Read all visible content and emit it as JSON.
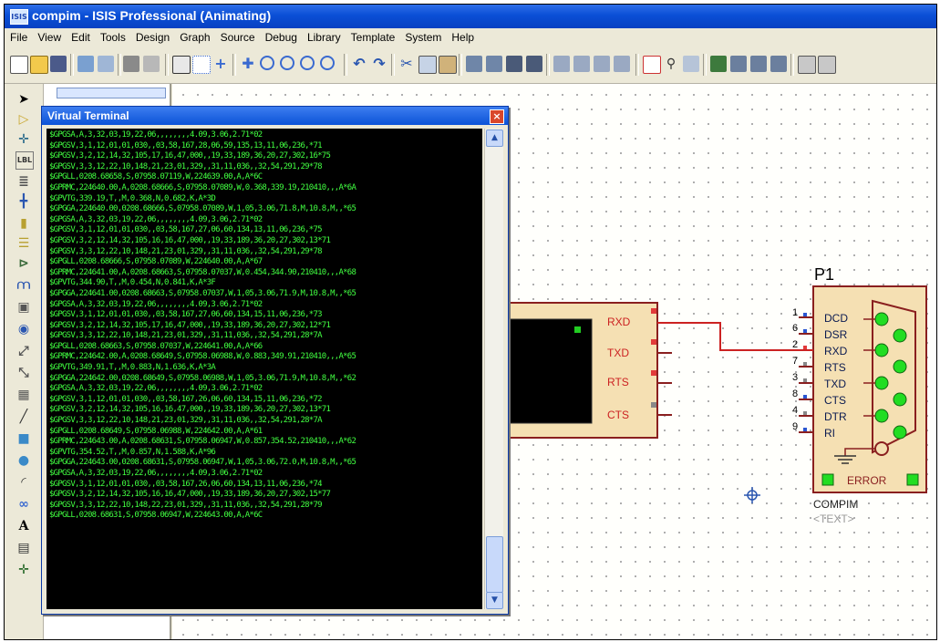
{
  "window": {
    "title": "compim - ISIS Professional (Animating)",
    "app_icon": "ISIS"
  },
  "menu": [
    "File",
    "View",
    "Edit",
    "Tools",
    "Design",
    "Graph",
    "Source",
    "Debug",
    "Library",
    "Template",
    "System",
    "Help"
  ],
  "terminal": {
    "title": "Virtual Terminal",
    "lines": [
      "$GPGSA,A,3,32,03,19,22,06,,,,,,,,4.09,3.06,2.71*02",
      "$GPGSV,3,1,12,01,01,030,,03,58,167,28,06,59,135,13,11,06,236,*71",
      "$GPGSV,3,2,12,14,32,105,17,16,47,000,,19,33,189,36,20,27,302,16*75",
      "$GPGSV,3,3,12,22,10,148,21,23,01,329,,31,11,036,,32,54,291,29*78",
      "$GPGLL,0208.68658,S,07958.07119,W,224639.00,A,A*6C",
      "$GPRMC,224640.00,A,0208.68666,S,07958.07089,W,0.368,339.19,210410,,,A*6A",
      "$GPVTG,339.19,T,,M,0.368,N,0.682,K,A*3D",
      "$GPGGA,224640.00,0208.68666,S,07958.07089,W,1,05,3.06,71.8,M,10.8,M,,*65",
      "$GPGSA,A,3,32,03,19,22,06,,,,,,,,4.09,3.06,2.71*02",
      "$GPGSV,3,1,12,01,01,030,,03,58,167,27,06,60,134,13,11,06,236,*75",
      "$GPGSV,3,2,12,14,32,105,16,16,47,000,,19,33,189,36,20,27,302,13*71",
      "$GPGSV,3,3,12,22,10,148,21,23,01,329,,31,11,036,,32,54,291,29*78",
      "$GPGLL,0208.68666,S,07958.07089,W,224640.00,A,A*67",
      "$GPRMC,224641.00,A,0208.68663,S,07958.07037,W,0.454,344.90,210410,,,A*68",
      "$GPVTG,344.90,T,,M,0.454,N,0.841,K,A*3F",
      "$GPGGA,224641.00,0208.68663,S,07958.07037,W,1,05,3.06,71.9,M,10.8,M,,*65",
      "$GPGSA,A,3,32,03,19,22,06,,,,,,,,4.09,3.06,2.71*02",
      "$GPGSV,3,1,12,01,01,030,,03,58,167,27,06,60,134,15,11,06,236,*73",
      "$GPGSV,3,2,12,14,32,105,17,16,47,000,,19,33,189,36,20,27,302,12*71",
      "$GPGSV,3,3,12,22,10,148,21,23,01,329,,31,11,036,,32,54,291,28*7A",
      "$GPGLL,0208.68663,S,07958.07037,W,224641.00,A,A*66",
      "$GPRMC,224642.00,A,0208.68649,S,07958.06988,W,0.883,349.91,210410,,,A*65",
      "$GPVTG,349.91,T,,M,0.883,N,1.636,K,A*3A",
      "$GPGGA,224642.00,0208.68649,S,07958.06988,W,1,05,3.06,71.9,M,10.8,M,,*62",
      "$GPGSA,A,3,32,03,19,22,06,,,,,,,,4.09,3.06,2.71*02",
      "$GPGSV,3,1,12,01,01,030,,03,58,167,26,06,60,134,15,11,06,236,*72",
      "$GPGSV,3,2,12,14,32,105,16,16,47,000,,19,33,189,36,20,27,302,13*71",
      "$GPGSV,3,3,12,22,10,148,21,23,01,329,,31,11,036,,32,54,291,28*7A",
      "$GPGLL,0208.68649,S,07958.06988,W,224642.00,A,A*61",
      "$GPRMC,224643.00,A,0208.68631,S,07958.06947,W,0.857,354.52,210410,,,A*62",
      "$GPVTG,354.52,T,,M,0.857,N,1.588,K,A*96",
      "$GPGGA,224643.00,0208.68631,S,07958.06947,W,1,05,3.06,72.0,M,10.8,M,,*65",
      "$GPGSA,A,3,32,03,19,22,06,,,,,,,,4.09,3.06,2.71*02",
      "$GPGSV,3,1,12,01,01,030,,03,58,167,26,06,60,134,13,11,06,236,*74",
      "$GPGSV,3,2,12,14,32,105,16,16,47,000,,19,33,189,36,20,27,302,15*77",
      "$GPGSV,3,3,12,22,10,148,22,23,01,329,,31,11,036,,32,54,291,28*79",
      "$GPGLL,0208.68631,S,07958.06947,W,224643.00,A,A*6C"
    ]
  },
  "left_component": {
    "pins": [
      "RXD",
      "TXD",
      "RTS",
      "CTS"
    ]
  },
  "compim": {
    "ref": "P1",
    "name": "COMPIM",
    "text": "<TEXT>",
    "pins": [
      {
        "num": "1",
        "label": "DCD"
      },
      {
        "num": "6",
        "label": "DSR"
      },
      {
        "num": "2",
        "label": "RXD"
      },
      {
        "num": "7",
        "label": "RTS"
      },
      {
        "num": "3",
        "label": "TXD"
      },
      {
        "num": "8",
        "label": "CTS"
      },
      {
        "num": "4",
        "label": "DTR"
      },
      {
        "num": "9",
        "label": "RI"
      }
    ],
    "error_label": "ERROR"
  },
  "colors": {
    "wire": "#cc2222",
    "component_fill": "#f5e0b3",
    "component_border": "#8a1f1f",
    "led": "#22cc22",
    "terminal_text": "#41ff41"
  }
}
